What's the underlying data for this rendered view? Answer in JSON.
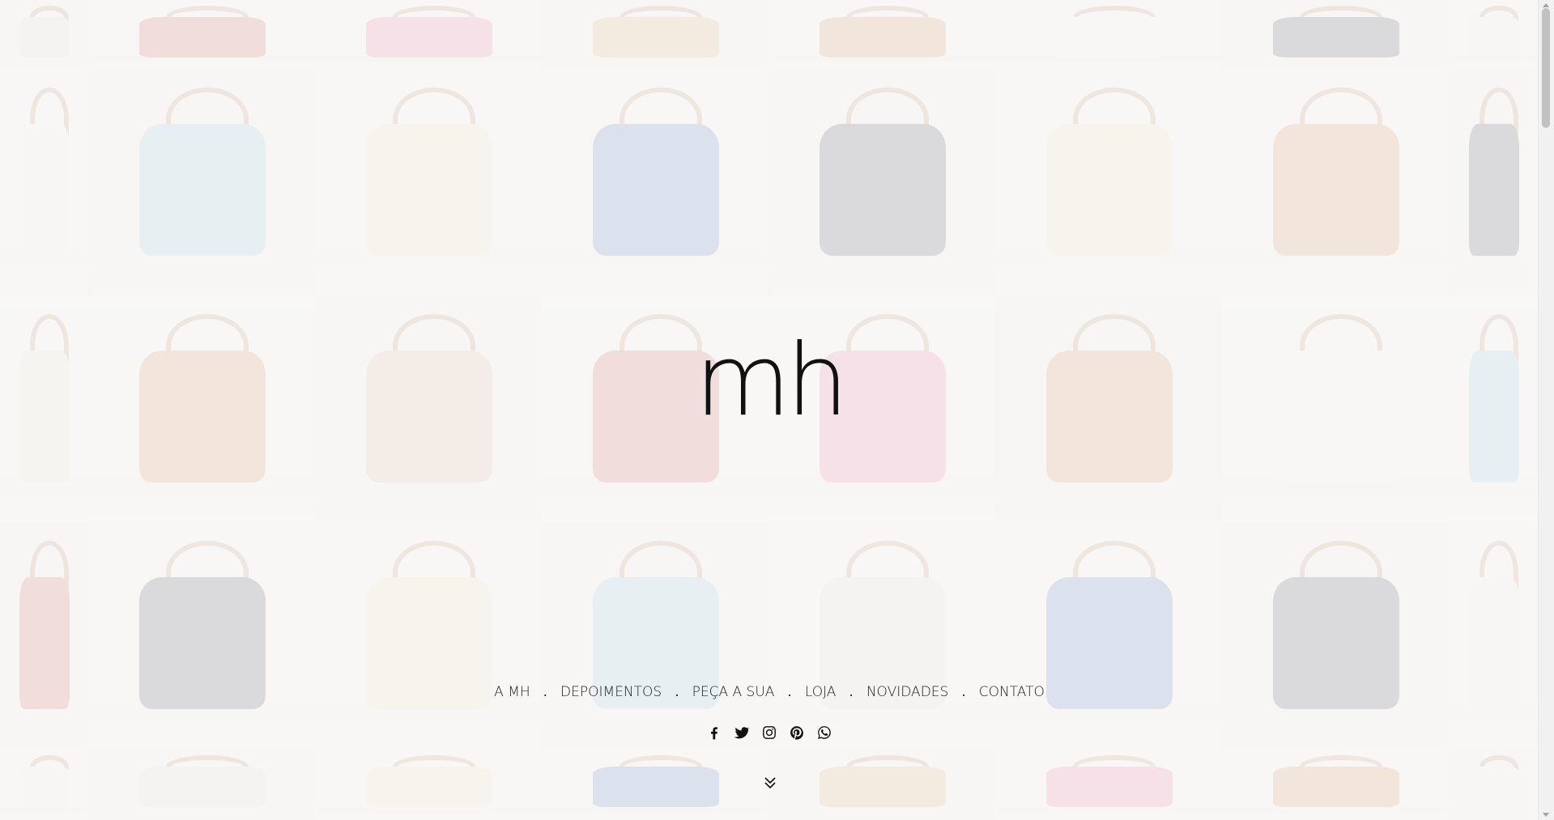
{
  "brand": {
    "logo_text": "mh"
  },
  "nav": {
    "items": [
      {
        "label": "A MH"
      },
      {
        "label": "DEPOIMENTOS"
      },
      {
        "label": "PEÇA A SUA"
      },
      {
        "label": "LOJA"
      },
      {
        "label": "NOVIDADES"
      },
      {
        "label": "CONTATO"
      }
    ],
    "separator": "."
  },
  "social": {
    "icons": [
      "facebook-icon",
      "twitter-icon",
      "instagram-icon",
      "pinterest-icon",
      "whatsapp-icon"
    ]
  },
  "colors": {
    "text": "#222222",
    "logo": "#111111",
    "page_bg": "#f7f5f3",
    "tile_palette": [
      "#b43a3a",
      "#2f5fae",
      "#7fb7d3",
      "#d39a5a",
      "#c97b3a",
      "#e9d8b5",
      "#1c2038",
      "#e35a8c",
      "#f2efe9",
      "#8a8a8a"
    ]
  },
  "mosaic": {
    "tiles": [
      "#d9d4cf",
      "#b43a3a",
      "#e35a8c",
      "#d39a5a",
      "#c97b3a",
      "#f2efe9",
      "#1c2038",
      "#e8e4df",
      "#e8e4df",
      "#7fb7d3",
      "#e9d8b5",
      "#2f5fae",
      "#1c2038",
      "#e9d8b5",
      "#c97b3a",
      "#1c2038",
      "#dcd6cf",
      "#c97b3a",
      "#d3a58a",
      "#b43a3a",
      "#e35a8c",
      "#c97b3a",
      "#f2efe9",
      "#7fb7d3",
      "#b43a3a",
      "#1c2038",
      "#e9d8b5",
      "#7fb7d3",
      "#d9d4cf",
      "#2f5fae",
      "#1c2038",
      "#e8e4df",
      "#e8e4df",
      "#d9d4cf",
      "#e9d8b5",
      "#2f5fae",
      "#d39a5a",
      "#e35a8c",
      "#c97b3a",
      "#e8e4df"
    ]
  }
}
